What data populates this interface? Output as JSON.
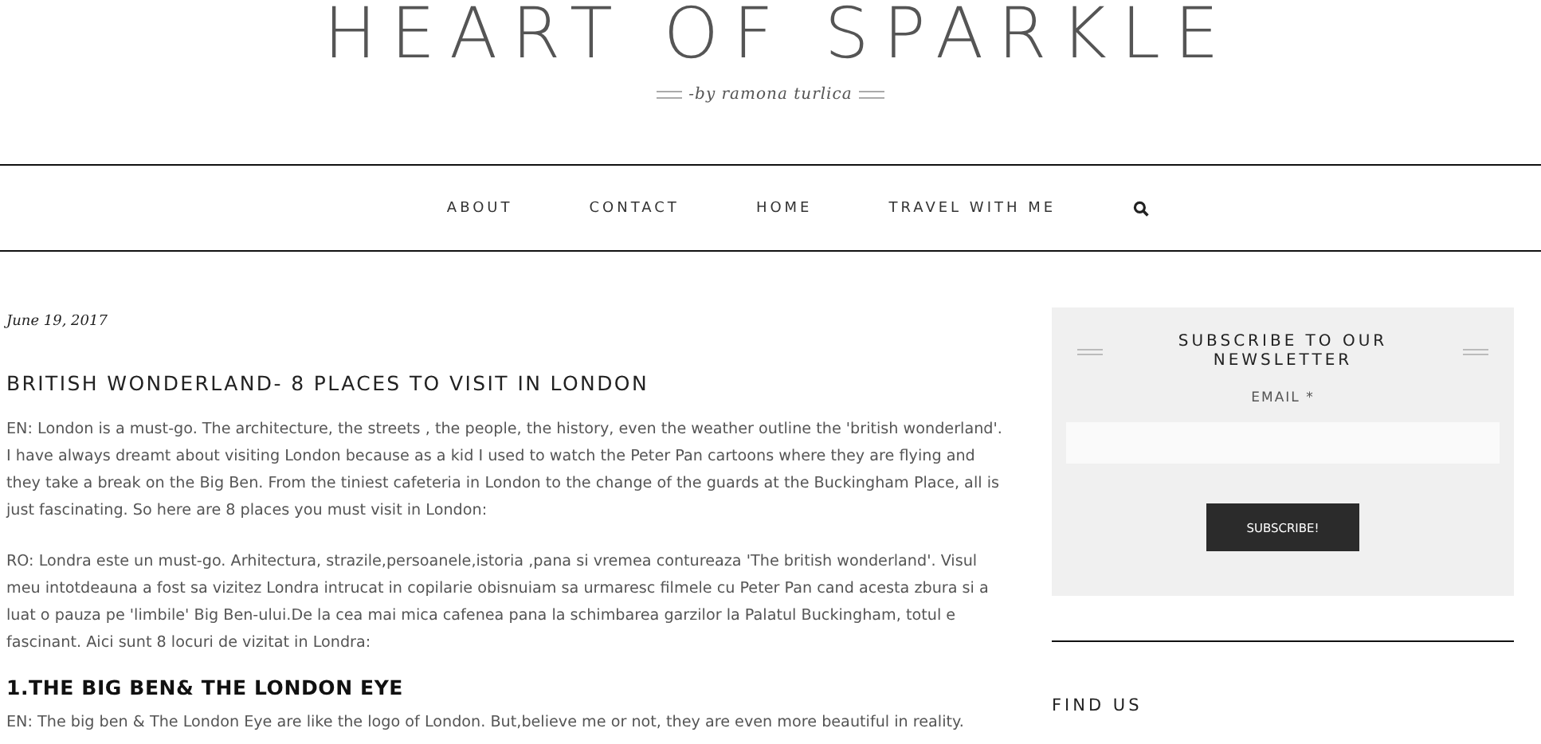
{
  "header": {
    "title": "HEART OF SPARKLE",
    "tagline": "-by ramona turlica"
  },
  "nav": {
    "items": [
      {
        "label": "ABOUT"
      },
      {
        "label": "CONTACT"
      },
      {
        "label": "HOME"
      },
      {
        "label": "TRAVEL WITH ME"
      }
    ]
  },
  "post": {
    "date": "June 19, 2017",
    "title": "BRITISH WONDERLAND- 8 PLACES TO VISIT IN LONDON",
    "paragraphs": [
      "EN: London is a must-go. The architecture, the streets , the people, the history, even the weather outline the 'british wonderland'. I have always dreamt about visiting London because as a kid I used to watch the Peter Pan cartoons where they are flying and they take a break on the Big Ben. From the tiniest cafeteria in London to the change of the guards at the Buckingham Place, all is just fascinating. So here are 8 places you must visit in London:",
      "RO: Londra este un must-go. Arhitectura, strazile,persoanele,istoria ,pana si vremea contureaza 'The british wonderland'. Visul meu intotdeauna a fost  sa vizitez Londra intrucat in copilarie obisnuiam sa urmaresc filmele cu Peter Pan cand acesta zbura si a luat o pauza pe 'limbile' Big Ben-ului.De la cea mai mica cafenea pana la schimbarea garzilor la Palatul Buckingham, totul e fascinant. Aici sunt 8 locuri de vizitat in Londra:"
    ],
    "section_heading": "1.THE BIG BEN& THE LONDON EYE",
    "section_text": "EN: The big ben & The London Eye are like the logo of London. But,believe me or not, they are even more beautiful in reality."
  },
  "sidebar": {
    "newsletter": {
      "title": "SUBSCRIBE TO OUR NEWSLETTER",
      "email_label": "EMAIL",
      "required_mark": "*",
      "button": "SUBSCRIBE!"
    },
    "find_us": "FIND US"
  }
}
